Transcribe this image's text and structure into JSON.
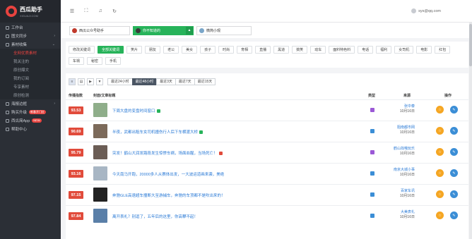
{
  "app": {
    "name": "西瓜助手",
    "sub": "XIGUAJI.COM"
  },
  "sidebar": {
    "items": [
      {
        "label": "工作台",
        "type": "top"
      },
      {
        "label": "图文同步",
        "type": "top",
        "caret": "›"
      },
      {
        "label": "素材收集",
        "type": "top",
        "caret": "⌄"
      },
      {
        "label": "全网优质素材",
        "type": "sub",
        "active": true
      },
      {
        "label": "我关注的",
        "type": "sub"
      },
      {
        "label": "原创爆文",
        "type": "sub"
      },
      {
        "label": "我的订阅",
        "type": "sub"
      },
      {
        "label": "专享素材",
        "type": "sub"
      },
      {
        "label": "原创检测",
        "type": "sub"
      },
      {
        "label": "海报边框",
        "type": "top",
        "caret": "›"
      },
      {
        "label": "购买升级",
        "type": "top",
        "badge": "新春开门红"
      },
      {
        "label": "西瓜简App",
        "type": "top",
        "badge": "NEW"
      },
      {
        "label": "帮助中心",
        "type": "top"
      }
    ]
  },
  "topbar": {
    "user": "sys@qq.com",
    "icons": [
      "menu-icon",
      "fullscreen-icon",
      "bell-icon",
      "refresh-icon"
    ]
  },
  "accounts": [
    {
      "label": "西瓜公众号助手",
      "selected": false
    },
    {
      "label": "你不知道的",
      "selected": true
    },
    {
      "label": "微简小观",
      "selected": false
    }
  ],
  "keywords": [
    "修改关键词",
    "全部关键词",
    "笑片",
    "朋友",
    "老公",
    "美女",
    "孩子",
    "时尚",
    "育相",
    "直播",
    "黑道",
    "搞笑",
    "动车",
    "面料特色料",
    "电话",
    "福利",
    "女司机",
    "电影",
    "红包",
    "车祸",
    "秘密",
    "手机"
  ],
  "filters": {
    "time": [
      "最近24小时",
      "最近48小时",
      "最近3天",
      "最近7天",
      "最近15天"
    ],
    "active_time": 1
  },
  "table": {
    "headers": {
      "score": "传播指数",
      "title": "封面/文章标题",
      "type": "类型",
      "source": "来源",
      "actions": "操作"
    },
    "rows": [
      {
        "score": "93.53",
        "title": "下周大盘的变盘时间窗口",
        "tag": "green",
        "type": "purple",
        "source": "张中泰",
        "date": "10月16日",
        "thumb": "#8fae8a"
      },
      {
        "score": "90.69",
        "title": "半夜，武都出租车女司机撞伤行人后下车横渡大桥",
        "tag": "green",
        "type": "blue",
        "source": "阻南都市网",
        "date": "10月16日",
        "thumb": "#7c6a5a"
      },
      {
        "score": "95.79",
        "title": "突发！鹤山大润发路段发生惊惨车祸，场面血腥，当场死亡！",
        "tag": "red",
        "type": "purple",
        "source": "鹤山找哦玩乐",
        "date": "10月16日",
        "thumb": "#6b5d55"
      },
      {
        "score": "93.16",
        "title": "今天南马开跑，20000多人从赛体出发，一大波运道画来袭，美绝",
        "tag": "",
        "type": "blue",
        "source": "南京大城小事",
        "date": "10月16日",
        "thumb": "#a8b6c4"
      },
      {
        "score": "97.15",
        "title": "奔驰GLE高速超车撞断大至游捕车，奔驰的车顶都不是吹出来的！",
        "tag": "",
        "type": "blue",
        "source": "百家车讯",
        "date": "10月16日",
        "thumb": "#222222"
      },
      {
        "score": "97.84",
        "title": "离开表礼？别逗了，五年后的这里，你高攀不起！",
        "tag": "",
        "type": "blue",
        "source": "大美表礼",
        "date": "10月16日",
        "thumb": "#5a7fa8"
      }
    ]
  },
  "colors": {
    "brand": "#e8433f",
    "accent": "#27b35a",
    "link": "#2a7ad6",
    "score": "#e14b3b"
  }
}
